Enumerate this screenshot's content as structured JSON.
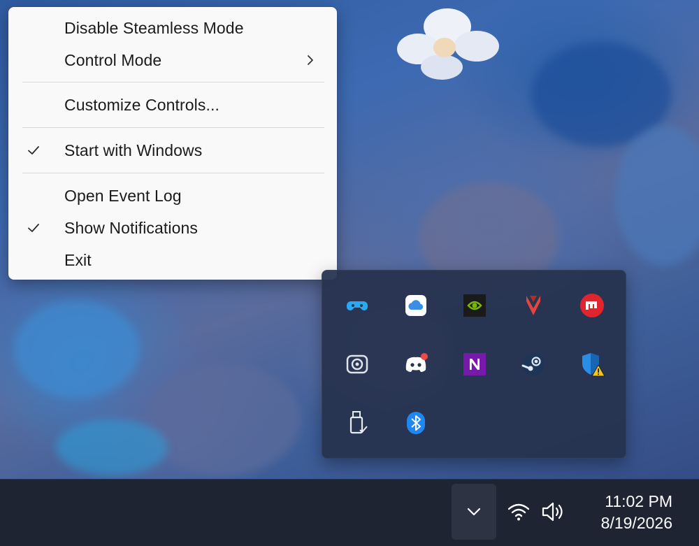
{
  "context_menu": {
    "items": [
      {
        "label": "Disable Steamless Mode",
        "checked": false,
        "submenu": false
      },
      {
        "label": "Control Mode",
        "checked": false,
        "submenu": true
      },
      {
        "label": "Customize Controls...",
        "checked": false,
        "submenu": false
      },
      {
        "label": "Start with Windows",
        "checked": true,
        "submenu": false
      },
      {
        "label": "Open Event Log",
        "checked": false,
        "submenu": false
      },
      {
        "label": "Show Notifications",
        "checked": true,
        "submenu": false
      },
      {
        "label": "Exit",
        "checked": false,
        "submenu": false
      }
    ]
  },
  "tray_overflow": {
    "icons": [
      {
        "name": "game-controller-icon",
        "color": "#2aa8f2"
      },
      {
        "name": "icloud-icon",
        "color": "#3a8ee6"
      },
      {
        "name": "nvidia-icon",
        "color": "#76b900"
      },
      {
        "name": "valorant-icon",
        "color": "#e5453b"
      },
      {
        "name": "riot-client-icon",
        "color": "#e0252f"
      },
      {
        "name": "camera-app-icon",
        "color": "#dfe3ea"
      },
      {
        "name": "discord-icon",
        "color": "#ffffff"
      },
      {
        "name": "onenote-icon",
        "color": "#7719aa"
      },
      {
        "name": "steam-icon",
        "color": "#dfe9f5"
      },
      {
        "name": "windows-security-icon",
        "color": "#2a8ee6"
      },
      {
        "name": "usb-drive-icon",
        "color": "#e8ecf2"
      },
      {
        "name": "bluetooth-icon",
        "color": "#1e88f0"
      }
    ]
  },
  "taskbar": {
    "show_hidden_icons": "chevron-up-icon",
    "time": "11:02 PM",
    "date": "8/19/2026"
  }
}
